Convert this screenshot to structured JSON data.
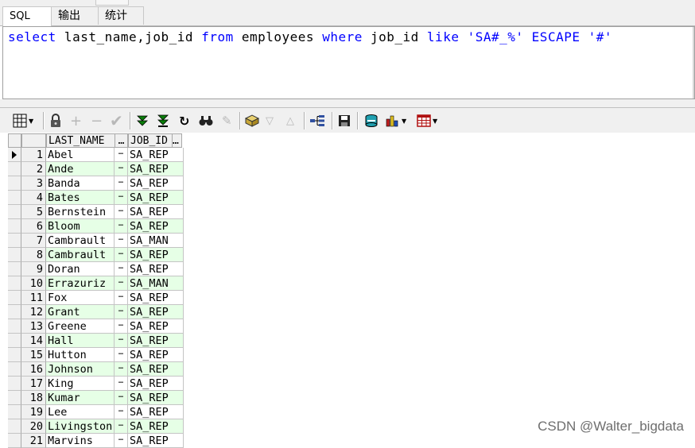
{
  "tabs": [
    {
      "label": "SQL",
      "active": true
    },
    {
      "label": "输出",
      "active": false
    },
    {
      "label": "统计",
      "active": false
    }
  ],
  "editor": {
    "tokens": [
      {
        "t": "select",
        "k": "kw"
      },
      {
        "t": " last_name,job_id ",
        "k": "txt"
      },
      {
        "t": "from",
        "k": "kw"
      },
      {
        "t": " employees ",
        "k": "txt"
      },
      {
        "t": "where",
        "k": "kw"
      },
      {
        "t": " job_id ",
        "k": "txt"
      },
      {
        "t": "like",
        "k": "kw"
      },
      {
        "t": " ",
        "k": "txt"
      },
      {
        "t": "'SA#_%'",
        "k": "str"
      },
      {
        "t": " ",
        "k": "txt"
      },
      {
        "t": "ESCAPE",
        "k": "kw"
      },
      {
        "t": " ",
        "k": "txt"
      },
      {
        "t": "'#'",
        "k": "str"
      }
    ]
  },
  "toolbar": {
    "icons": [
      "grid-view-icon",
      "lock-icon",
      "add-record-icon",
      "delete-record-icon",
      "post-record-icon",
      "fetch-next-icon",
      "fetch-last-icon",
      "refresh-icon",
      "find-icon",
      "clear-icon",
      "query-by-example-icon",
      "filter-down-icon",
      "filter-up-icon",
      "export-tree-icon",
      "save-icon",
      "export-data-icon",
      "chart-icon",
      "table-icon"
    ]
  },
  "grid": {
    "columns": [
      {
        "label": "LAST_NAME"
      },
      {
        "label": "JOB_ID"
      }
    ],
    "ellipsis": "…",
    "rows": [
      {
        "n": "1",
        "last_name": "Abel",
        "job_id": "SA_REP"
      },
      {
        "n": "2",
        "last_name": "Ande",
        "job_id": "SA_REP"
      },
      {
        "n": "3",
        "last_name": "Banda",
        "job_id": "SA_REP"
      },
      {
        "n": "4",
        "last_name": "Bates",
        "job_id": "SA_REP"
      },
      {
        "n": "5",
        "last_name": "Bernstein",
        "job_id": "SA_REP"
      },
      {
        "n": "6",
        "last_name": "Bloom",
        "job_id": "SA_REP"
      },
      {
        "n": "7",
        "last_name": "Cambrault",
        "job_id": "SA_MAN"
      },
      {
        "n": "8",
        "last_name": "Cambrault",
        "job_id": "SA_REP"
      },
      {
        "n": "9",
        "last_name": "Doran",
        "job_id": "SA_REP"
      },
      {
        "n": "10",
        "last_name": "Errazuriz",
        "job_id": "SA_MAN"
      },
      {
        "n": "11",
        "last_name": "Fox",
        "job_id": "SA_REP"
      },
      {
        "n": "12",
        "last_name": "Grant",
        "job_id": "SA_REP"
      },
      {
        "n": "13",
        "last_name": "Greene",
        "job_id": "SA_REP"
      },
      {
        "n": "14",
        "last_name": "Hall",
        "job_id": "SA_REP"
      },
      {
        "n": "15",
        "last_name": "Hutton",
        "job_id": "SA_REP"
      },
      {
        "n": "16",
        "last_name": "Johnson",
        "job_id": "SA_REP"
      },
      {
        "n": "17",
        "last_name": "King",
        "job_id": "SA_REP"
      },
      {
        "n": "18",
        "last_name": "Kumar",
        "job_id": "SA_REP"
      },
      {
        "n": "19",
        "last_name": "Lee",
        "job_id": "SA_REP"
      },
      {
        "n": "20",
        "last_name": "Livingston",
        "job_id": "SA_REP"
      },
      {
        "n": "21",
        "last_name": "Marvins",
        "job_id": "SA_REP"
      }
    ]
  },
  "watermark": "CSDN @Walter_bigdata",
  "colors": {
    "keyword": "#0000ff",
    "alt_row": "#e6ffe6"
  }
}
